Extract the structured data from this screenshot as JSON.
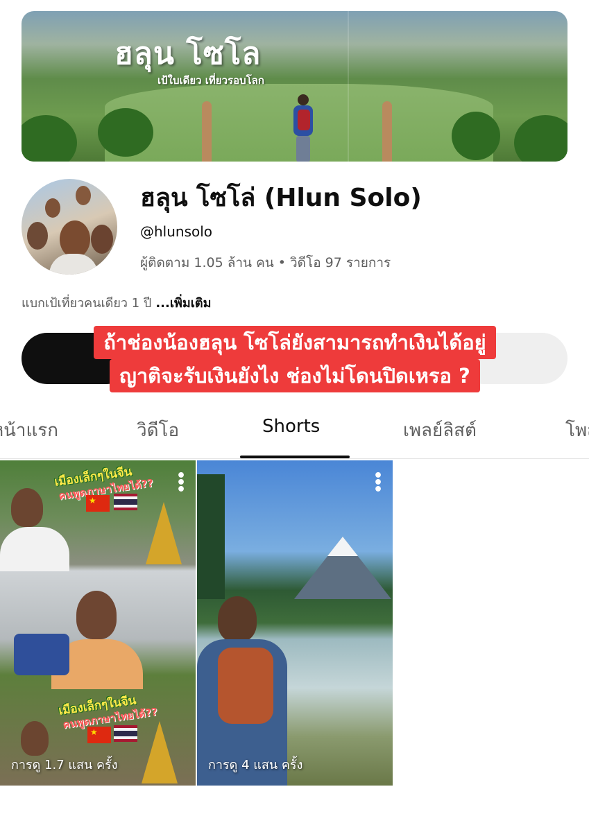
{
  "banner": {
    "title": "ฮลุน โซโล",
    "subtitle": "เป้ใบเดียว เที่ยวรอบโลก"
  },
  "channel": {
    "name": "ฮลุน โซโล่ (Hlun Solo)",
    "handle": "@hlunsolo",
    "subscribers": "ผู้ติดตาม 1.05 ล้าน คน",
    "separator": "•",
    "videos": "วิดีโอ 97 รายการ",
    "description": "แบกเป้เที่ยวคนเดียว 1 ปี",
    "more_label": "...เพิ่มเติม"
  },
  "overlay": {
    "line1": "ถ้าช่องน้องฮลุน โซโล่ยังสามารถทำเงินได้อยู่",
    "line2": "ญาติจะรับเงินยังไง ช่องไม่โดนปิดเหรอ ?"
  },
  "tabs": [
    {
      "label": "หน้าแรก"
    },
    {
      "label": "วิดีโอ"
    },
    {
      "label": "Shorts",
      "active": true
    },
    {
      "label": "เพลย์ลิสต์"
    },
    {
      "label": "โพสต์"
    }
  ],
  "shorts": [
    {
      "views": "การดู 1.7 แสน ครั้ง",
      "caption": "เมืองเล็กๆในจีน",
      "subcaption": "คนพูดภาษาไทยได้??"
    },
    {
      "views": "การดู 4 แสน ครั้ง"
    }
  ],
  "icons": {
    "more": "more-vert-icon"
  },
  "colors": {
    "overlay_red": "#ee3b3b",
    "text_primary": "#0f0f0f",
    "text_secondary": "#606060"
  }
}
